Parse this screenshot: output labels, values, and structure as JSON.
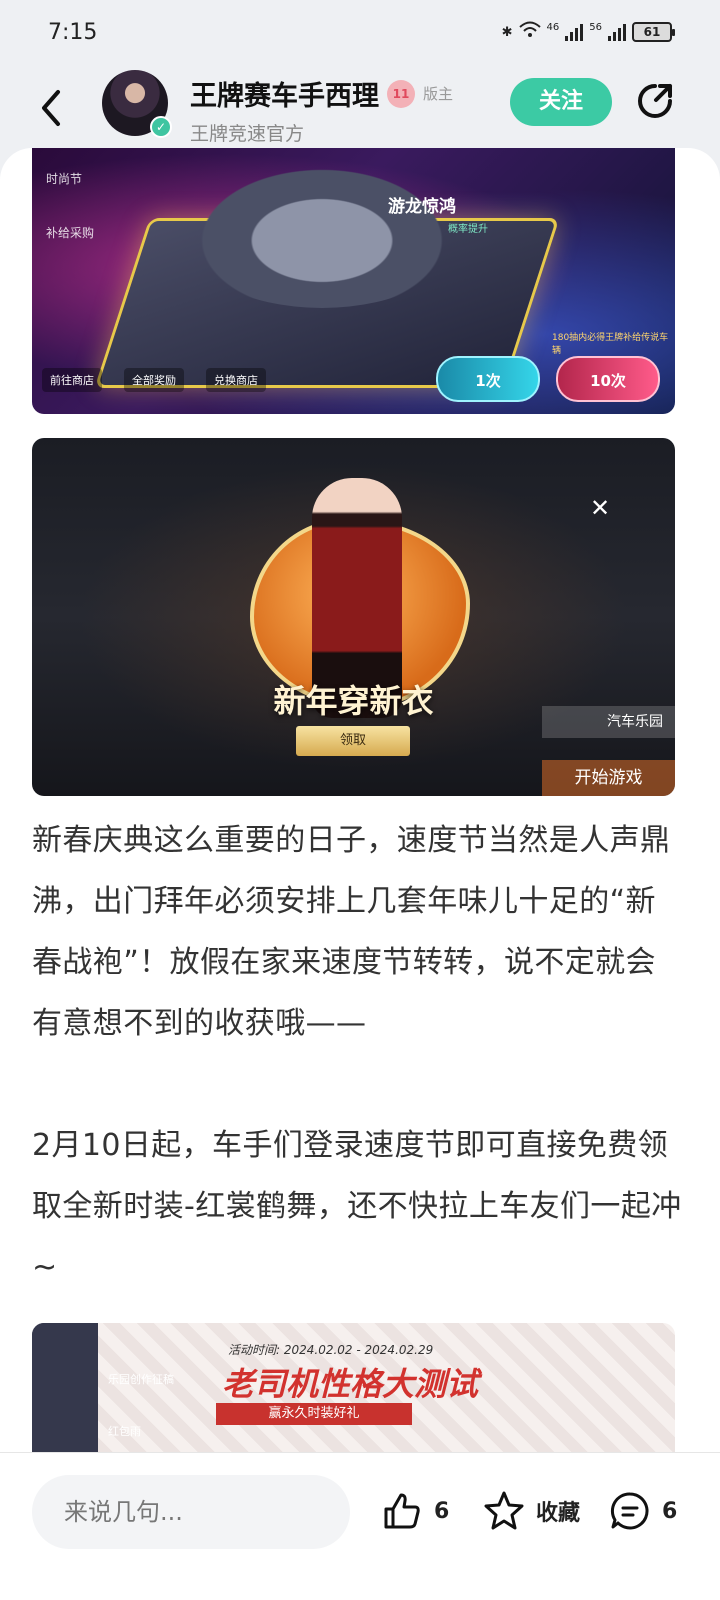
{
  "status_bar": {
    "time": "7:15",
    "network_1": "46",
    "network_2": "56",
    "battery": "61"
  },
  "header": {
    "user_name": "王牌赛车手西理",
    "level_badge": "11",
    "role_badge": "版主",
    "subtitle": "王牌竞速官方",
    "follow_label": "关注"
  },
  "image1": {
    "label_fashion": "时尚节",
    "label_supply": "补给采购",
    "title": "游龙惊鸿",
    "tag": "概率提升",
    "note": "180抽内必得王牌补给传说车辆",
    "btn_once": "1次",
    "btn_ten": "10次",
    "link_shop": "前往商店",
    "link_rewards": "全部奖励",
    "link_exchange": "兑换商店"
  },
  "image2": {
    "title": "新年穿新衣",
    "claim": "领取",
    "garden": "汽车乐园",
    "start": "开始游戏"
  },
  "article": {
    "para1": "新春庆典这么重要的日子，速度节当然是人声鼎沸，出门拜年必须安排上几套年味儿十足的“新春战袍”！放假在家来速度节转转，说不定就会有意想不到的收获哦——",
    "para2": "2月10日起，车手们登录速度节即可直接免费领取全新时装-红裳鹤舞，还不快拉上车友们一起冲~"
  },
  "image3": {
    "date": "活动时间: 2024.02.02 - 2024.02.29",
    "title": "老司机性格大测试",
    "subtitle": "赢永久时装好礼",
    "side_tag": "乐园创作征稿",
    "side_tag2": "红包雨"
  },
  "bottom_bar": {
    "comment_placeholder": "来说几句...",
    "like_count": "6",
    "favorite_label": "收藏",
    "comment_count": "6"
  },
  "colors": {
    "accent": "#3ccaa4",
    "background": "#eef0f3"
  }
}
